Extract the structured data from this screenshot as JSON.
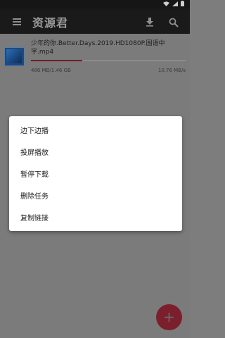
{
  "status_bar": {
    "icons": [
      "wifi-icon",
      "signal-icon",
      "battery-icon"
    ]
  },
  "app_bar": {
    "title": "资源君",
    "menu_icon": "menu-icon",
    "download_icon": "download-icon",
    "search_icon": "search-icon"
  },
  "task": {
    "name": "少年的你.Better.Days.2019.HD1080P.国语中字.mp4",
    "size": "486 MB/1.46 GB",
    "speed": "10.76 MB/s",
    "progress": 0.33
  },
  "dialog": {
    "items": [
      {
        "label": "边下边播"
      },
      {
        "label": "投屏播放"
      },
      {
        "label": "暂停下载"
      },
      {
        "label": "删除任务"
      },
      {
        "label": "复制链接"
      }
    ]
  },
  "fab": {
    "label": "+"
  },
  "colors": {
    "accent": "#c0283e",
    "app_bar": "#1e1e1e",
    "scrim": "#7b7b7b"
  }
}
